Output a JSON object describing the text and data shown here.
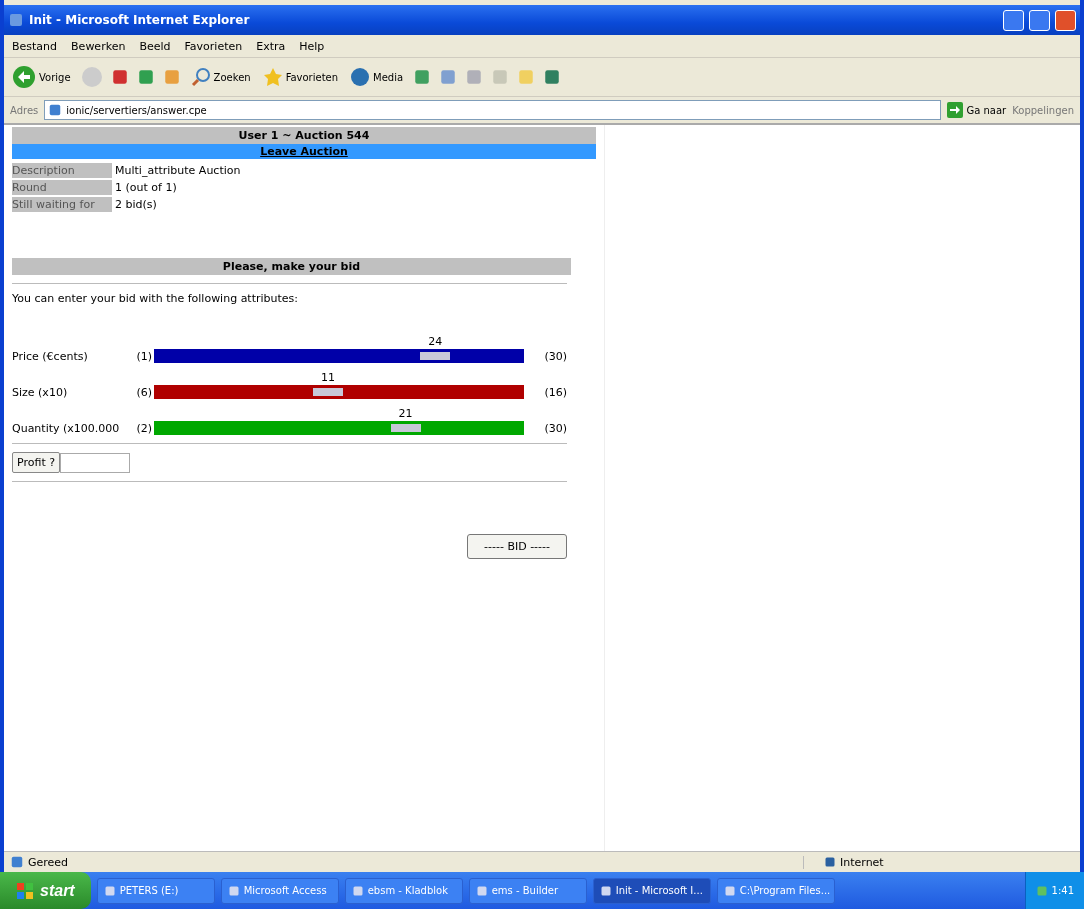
{
  "window": {
    "title": "Init - Microsoft Internet Explorer"
  },
  "menu": [
    "Bestand",
    "Bewerken",
    "Beeld",
    "Favorieten",
    "Extra",
    "Help"
  ],
  "toolbar": {
    "back": "Vorige",
    "search": "Zoeken",
    "favorites": "Favorieten",
    "media": "Media"
  },
  "address_bar": {
    "label": "Adres",
    "url": "ionic/servertiers/answer.cpe",
    "go": "Ga naar",
    "links": "Koppelingen"
  },
  "page": {
    "header": "User 1 ~ Auction 544",
    "leave_link": "Leave Auction",
    "info": [
      {
        "label": "Description",
        "value": "Multi_attribute Auction"
      },
      {
        "label": "Round",
        "value": "1 (out of 1)"
      },
      {
        "label": "Still waiting for",
        "value": "2 bid(s)"
      }
    ],
    "bid_header": "Please, make your bid",
    "intro": "You can enter your bid with the following attributes:",
    "sliders": [
      {
        "label": "Price (€cents)",
        "min": "(1)",
        "max": "(30)",
        "value": "24",
        "level": 0.76,
        "color": "#0000a8"
      },
      {
        "label": "Size (x10)",
        "min": "(6)",
        "max": "(16)",
        "value": "11",
        "level": 0.47,
        "color": "#b00000"
      },
      {
        "label": "Quantity (x100.000",
        "min": "(2)",
        "max": "(30)",
        "value": "21",
        "level": 0.68,
        "color": "#00a800"
      }
    ],
    "profit_button": "Profit ?",
    "bid_button": "----- BID -----"
  },
  "status_bar": {
    "text": "Gereed",
    "zone": "Internet"
  },
  "taskbar": {
    "start": "start",
    "items": [
      {
        "label": "PETERS (E:)",
        "selected": false
      },
      {
        "label": "Microsoft Access",
        "selected": false
      },
      {
        "label": "ebsm - Kladblok",
        "selected": false
      },
      {
        "label": "ems - Builder",
        "selected": false
      },
      {
        "label": "Init - Microsoft I...",
        "selected": true
      },
      {
        "label": "C:\\Program Files...",
        "selected": false
      }
    ],
    "clock": "1:41"
  }
}
